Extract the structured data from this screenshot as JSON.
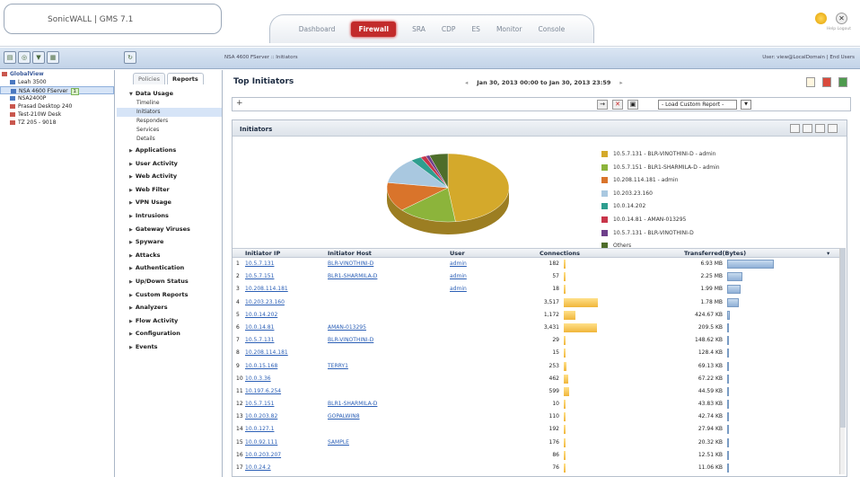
{
  "app": {
    "brand": "SonicWALL | GMS 7.1"
  },
  "tabs": [
    "Dashboard",
    "Firewall",
    "SRA",
    "CDP",
    "ES",
    "Monitor",
    "Console"
  ],
  "active_tab": "Firewall",
  "top_right": {
    "help": "Help",
    "logout": "Logout"
  },
  "path": "NSA 4600 FServer :: Initiators",
  "user_info": "User: view@LocalDomain | End Users",
  "tree": {
    "root": "GlobalView",
    "children": [
      "Leah 3500",
      "NSA 4600 FServer",
      "NSA2400P",
      "Prasad Desktop 240",
      "Test-210W Desk",
      "TZ 205 - 9018"
    ]
  },
  "nav": {
    "tabs": [
      "Policies",
      "Reports"
    ],
    "sections": [
      {
        "label": "Data Usage",
        "expanded": true,
        "items": [
          "Timeline",
          "Initiators",
          "Responders",
          "Services",
          "Details"
        ]
      },
      {
        "label": "Applications"
      },
      {
        "label": "User Activity"
      },
      {
        "label": "Web Activity"
      },
      {
        "label": "Web Filter"
      },
      {
        "label": "VPN Usage"
      },
      {
        "label": "Intrusions"
      },
      {
        "label": "Gateway Viruses"
      },
      {
        "label": "Spyware"
      },
      {
        "label": "Attacks"
      },
      {
        "label": "Authentication"
      },
      {
        "label": "Up/Down Status"
      },
      {
        "label": "Custom Reports"
      },
      {
        "label": "Analyzers"
      },
      {
        "label": "Flow Activity"
      },
      {
        "label": "Configuration"
      },
      {
        "label": "Events"
      }
    ]
  },
  "main": {
    "title": "Top Initiators",
    "date_range": "Jan 30, 2013 00:00 to Jan 30, 2013 23:59",
    "load_report": "- Load Custom Report -",
    "panel_title": "Initiators"
  },
  "chart_data": {
    "type": "pie",
    "title": "",
    "legend_position": "right",
    "categories": [
      "10.5.7.131 - BLR-VINOTHINI-D - admin",
      "10.5.7.151 - BLR1-SHARMILA-D - admin",
      "10.208.114.181 - admin",
      "10.203.23.160",
      "10.0.14.202",
      "10.0.14.81 - AMAN-013295",
      "10.5.7.131 - BLR-VINOTHINI-D",
      "Others"
    ],
    "values": [
      6.93,
      2.25,
      1.99,
      1.78,
      0.4147,
      0.2085,
      0.1448,
      0.71
    ],
    "colors": [
      "#d4a92b",
      "#8cb43b",
      "#d9742b",
      "#a9c8e0",
      "#2e9e8f",
      "#c8354a",
      "#6e3f8a",
      "#4e6d2a"
    ]
  },
  "grid": {
    "headers": [
      "Initiator IP",
      "Initiator Host",
      "User",
      "Connections",
      "Transferred(Bytes)"
    ],
    "rows": [
      {
        "n": "1",
        "ip": "10.5.7.131",
        "host": "BLR-VINOTHINI-D",
        "user": "admin",
        "conn": "182",
        "conn_v": 182,
        "bytes": "6.93 MB",
        "bytes_v": 6930
      },
      {
        "n": "2",
        "ip": "10.5.7.151",
        "host": "BLR1-SHARMILA-D",
        "user": "admin",
        "conn": "57",
        "conn_v": 57,
        "bytes": "2.25 MB",
        "bytes_v": 2250
      },
      {
        "n": "3",
        "ip": "10.208.114.181",
        "host": "",
        "user": "admin",
        "conn": "18",
        "conn_v": 18,
        "bytes": "1.99 MB",
        "bytes_v": 1990
      },
      {
        "n": "4",
        "ip": "10.203.23.160",
        "host": "",
        "user": "",
        "conn": "3,517",
        "conn_v": 3517,
        "bytes": "1.78 MB",
        "bytes_v": 1780
      },
      {
        "n": "5",
        "ip": "10.0.14.202",
        "host": "",
        "user": "",
        "conn": "1,172",
        "conn_v": 1172,
        "bytes": "424.67 KB",
        "bytes_v": 424.67
      },
      {
        "n": "6",
        "ip": "10.0.14.81",
        "host": "AMAN-013295",
        "user": "",
        "conn": "3,431",
        "conn_v": 3431,
        "bytes": "209.5 KB",
        "bytes_v": 209.5
      },
      {
        "n": "7",
        "ip": "10.5.7.131",
        "host": "BLR-VINOTHINI-D",
        "user": "",
        "conn": "29",
        "conn_v": 29,
        "bytes": "148.62 KB",
        "bytes_v": 148.62
      },
      {
        "n": "8",
        "ip": "10.208.114.181",
        "host": "",
        "user": "",
        "conn": "15",
        "conn_v": 15,
        "bytes": "128.4 KB",
        "bytes_v": 128.4
      },
      {
        "n": "9",
        "ip": "10.0.15.168",
        "host": "TERRY1",
        "user": "",
        "conn": "253",
        "conn_v": 253,
        "bytes": "69.13 KB",
        "bytes_v": 69.13
      },
      {
        "n": "10",
        "ip": "10.0.3.36",
        "host": "",
        "user": "",
        "conn": "462",
        "conn_v": 462,
        "bytes": "67.22 KB",
        "bytes_v": 67.22
      },
      {
        "n": "11",
        "ip": "10.197.6.254",
        "host": "",
        "user": "",
        "conn": "599",
        "conn_v": 599,
        "bytes": "44.59 KB",
        "bytes_v": 44.59
      },
      {
        "n": "12",
        "ip": "10.5.7.151",
        "host": "BLR1-SHARMILA-D",
        "user": "",
        "conn": "10",
        "conn_v": 10,
        "bytes": "43.83 KB",
        "bytes_v": 43.83
      },
      {
        "n": "13",
        "ip": "10.0.203.82",
        "host": "GOPALWIN8",
        "user": "",
        "conn": "110",
        "conn_v": 110,
        "bytes": "42.74 KB",
        "bytes_v": 42.74
      },
      {
        "n": "14",
        "ip": "10.0.127.1",
        "host": "",
        "user": "",
        "conn": "192",
        "conn_v": 192,
        "bytes": "27.94 KB",
        "bytes_v": 27.94
      },
      {
        "n": "15",
        "ip": "10.0.92.111",
        "host": "SAMPLE",
        "user": "",
        "conn": "176",
        "conn_v": 176,
        "bytes": "20.32 KB",
        "bytes_v": 20.32
      },
      {
        "n": "16",
        "ip": "10.0.203.207",
        "host": "",
        "user": "",
        "conn": "86",
        "conn_v": 86,
        "bytes": "12.51 KB",
        "bytes_v": 12.51
      },
      {
        "n": "17",
        "ip": "10.0.24.2",
        "host": "",
        "user": "",
        "conn": "76",
        "conn_v": 76,
        "bytes": "11.06 KB",
        "bytes_v": 11.06
      }
    ]
  }
}
